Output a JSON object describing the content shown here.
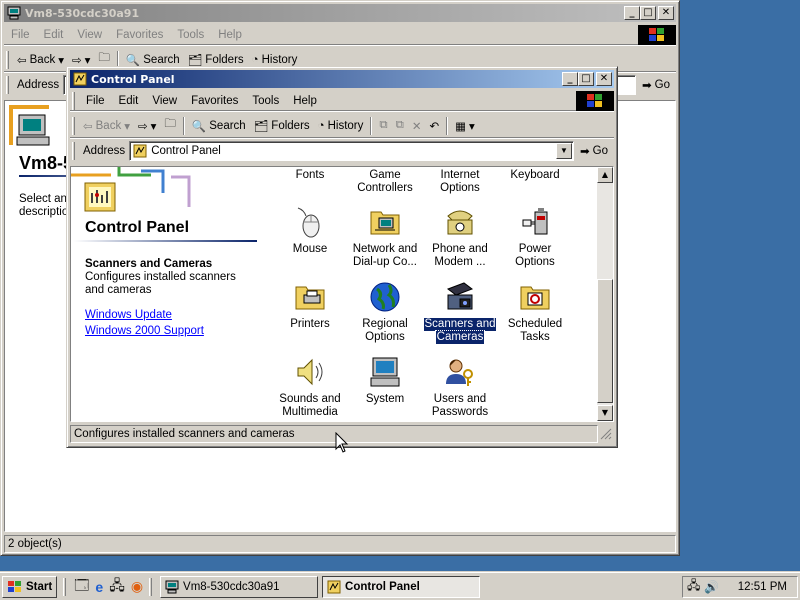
{
  "back_window": {
    "title": "Vm8-530cdc30a91",
    "menu": [
      "File",
      "Edit",
      "View",
      "Favorites",
      "Tools",
      "Help"
    ],
    "toolbar": {
      "back": "Back",
      "search": "Search",
      "folders": "Folders",
      "history": "History"
    },
    "address_label": "Address",
    "go_label": "Go",
    "heading": "Vm8-5",
    "desc_line1": "Select an i",
    "desc_line2": "description",
    "status": "2 object(s)"
  },
  "front_window": {
    "title": "Control Panel",
    "menu": [
      "File",
      "Edit",
      "View",
      "Favorites",
      "Tools",
      "Help"
    ],
    "toolbar": {
      "back": "Back",
      "search": "Search",
      "folders": "Folders",
      "history": "History"
    },
    "address_label": "Address",
    "address_value": "Control Panel",
    "go_label": "Go",
    "panel_title": "Control Panel",
    "selected_name": "Scanners and Cameras",
    "selected_desc": "Configures installed scanners and cameras",
    "links": [
      "Windows Update",
      "Windows 2000 Support"
    ],
    "top_row": [
      {
        "l1": "Fonts",
        "l2": ""
      },
      {
        "l1": "Game",
        "l2": "Controllers"
      },
      {
        "l1": "Internet",
        "l2": "Options"
      },
      {
        "l1": "Keyboard",
        "l2": ""
      }
    ],
    "icons": [
      {
        "l1": "Mouse",
        "l2": "",
        "icon": "mouse-icon"
      },
      {
        "l1": "Network and",
        "l2": "Dial-up Co...",
        "icon": "network-icon"
      },
      {
        "l1": "Phone and",
        "l2": "Modem ...",
        "icon": "phone-icon"
      },
      {
        "l1": "Power Options",
        "l2": "",
        "icon": "power-icon"
      },
      {
        "l1": "Printers",
        "l2": "",
        "icon": "printer-icon"
      },
      {
        "l1": "Regional",
        "l2": "Options",
        "icon": "globe-icon"
      },
      {
        "l1": "Scanners and",
        "l2": "Cameras",
        "icon": "scanner-icon"
      },
      {
        "l1": "Scheduled",
        "l2": "Tasks",
        "icon": "scheduled-tasks-icon"
      },
      {
        "l1": "Sounds and",
        "l2": "Multimedia",
        "icon": "speaker-icon"
      },
      {
        "l1": "System",
        "l2": "",
        "icon": "computer-icon"
      },
      {
        "l1": "Users and",
        "l2": "Passwords",
        "icon": "users-icon"
      }
    ],
    "status": "Configures installed scanners and cameras"
  },
  "taskbar": {
    "start": "Start",
    "tasks": [
      "Vm8-530cdc30a91",
      "Control Panel"
    ],
    "clock": "12:51 PM"
  },
  "colors": {
    "desktop": "#3a6ea5",
    "title_active": "#0a246a",
    "selection": "#0a246a"
  }
}
